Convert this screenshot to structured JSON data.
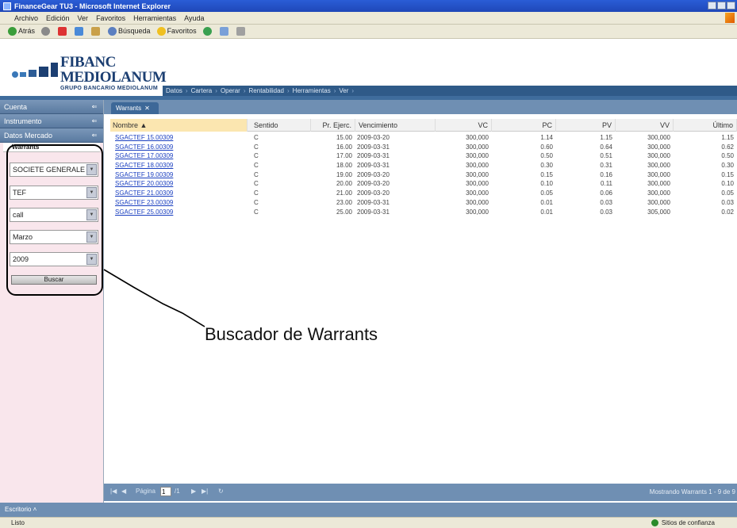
{
  "window": {
    "title": "FinanceGear TU3 - Microsoft Internet Explorer"
  },
  "ie_menu": [
    "Archivo",
    "Edición",
    "Ver",
    "Favoritos",
    "Herramientas",
    "Ayuda"
  ],
  "ie_toolbar": {
    "back": "Atrás",
    "search": "Búsqueda",
    "favorites": "Favoritos"
  },
  "brand": {
    "line1": "FIBANC",
    "line2": "MEDIOLANUM",
    "sub": "GRUPO BANCARIO MEDIOLANUM"
  },
  "main_nav": [
    "Datos",
    "Cartera",
    "Operar",
    "Rentabilidad",
    "Herramientas",
    "Ver"
  ],
  "sidebar": {
    "sections": [
      "Cuenta",
      "Instrumento",
      "Datos Mercado"
    ],
    "subsection": "Warrants",
    "fields": [
      {
        "value": "SOCIETE GENERALE"
      },
      {
        "value": "TEF"
      },
      {
        "value": "call"
      },
      {
        "value": "Marzo"
      },
      {
        "value": "2009"
      }
    ],
    "search_label": "Buscar"
  },
  "tab": {
    "label": "Warrants"
  },
  "grid": {
    "columns": [
      "Nombre ▲",
      "Sentido",
      "Pr. Ejerc.",
      "Vencimiento",
      "VC",
      "PC",
      "PV",
      "VV",
      "Último"
    ],
    "rows": [
      [
        "SGACTEF 15.00309",
        "C",
        "15.00",
        "2009-03-20",
        "300,000",
        "1.14",
        "1.15",
        "300,000",
        "1.15"
      ],
      [
        "SGACTEF 16.00309",
        "C",
        "16.00",
        "2009-03-31",
        "300,000",
        "0.60",
        "0.64",
        "300,000",
        "0.62"
      ],
      [
        "SGACTEF 17.00309",
        "C",
        "17.00",
        "2009-03-31",
        "300,000",
        "0.50",
        "0.51",
        "300,000",
        "0.50"
      ],
      [
        "SGACTEF 18.00309",
        "C",
        "18.00",
        "2009-03-31",
        "300,000",
        "0.30",
        "0.31",
        "300,000",
        "0.30"
      ],
      [
        "SGACTEF 19.00309",
        "C",
        "19.00",
        "2009-03-20",
        "300,000",
        "0.15",
        "0.16",
        "300,000",
        "0.15"
      ],
      [
        "SGACTEF 20.00309",
        "C",
        "20.00",
        "2009-03-20",
        "300,000",
        "0.10",
        "0.11",
        "300,000",
        "0.10"
      ],
      [
        "SGACTEF 21.00309",
        "C",
        "21.00",
        "2009-03-20",
        "300,000",
        "0.05",
        "0.06",
        "300,000",
        "0.05"
      ],
      [
        "SGACTEF 23.00309",
        "C",
        "23.00",
        "2009-03-31",
        "300,000",
        "0.01",
        "0.03",
        "300,000",
        "0.03"
      ],
      [
        "SGACTEF 25.00309",
        "C",
        "25.00",
        "2009-03-31",
        "300,000",
        "0.01",
        "0.03",
        "305,000",
        "0.02"
      ]
    ]
  },
  "pager": {
    "page_label": "Página",
    "page_value": "1",
    "of_label": "/1",
    "showing": "Mostrando Warrants 1 - 9 de 9"
  },
  "bottom_bar": {
    "label": "Escritorio"
  },
  "status": {
    "left": "Listo",
    "zone": "Sitios de confianza"
  },
  "annotation": {
    "text": "Buscador de Warrants"
  }
}
